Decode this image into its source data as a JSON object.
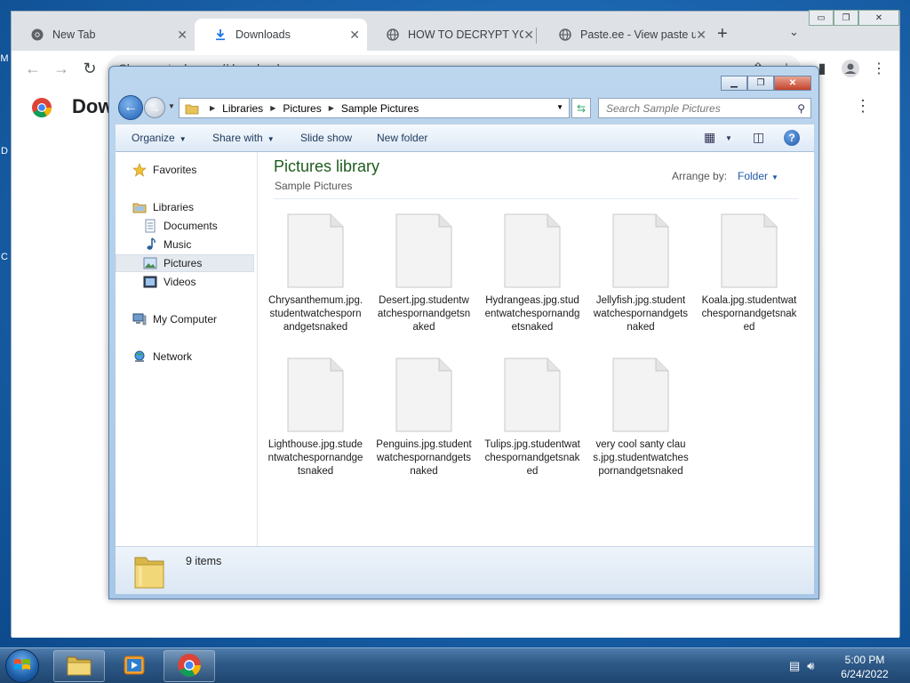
{
  "desktop": {
    "edge_letters": [
      "M",
      "D",
      "C"
    ]
  },
  "chrome": {
    "tabs": [
      {
        "label": "New Tab",
        "icon": "chrome-icon",
        "active": false
      },
      {
        "label": "Downloads",
        "icon": "download-icon",
        "active": true
      },
      {
        "label": "HOW TO DECRYPT YOUR FILES",
        "icon": "globe-icon",
        "active": false
      },
      {
        "label": "Paste.ee - View paste uS",
        "icon": "globe-icon",
        "active": false
      }
    ],
    "new_tab_label": "+",
    "tab_search_label": "⌄",
    "omnibox": {
      "site": "Chrome",
      "url": "chrome://downloads"
    },
    "page_heading": "Dow",
    "window_buttons": [
      "▭",
      "❐",
      "✕"
    ]
  },
  "explorer": {
    "breadcrumb": [
      "Libraries",
      "Pictures",
      "Sample Pictures"
    ],
    "search_placeholder": "Search Sample Pictures",
    "commands": [
      {
        "label": "Organize",
        "has_dropdown": true
      },
      {
        "label": "Share with",
        "has_dropdown": true
      },
      {
        "label": "Slide show",
        "has_dropdown": false
      },
      {
        "label": "New folder",
        "has_dropdown": false
      }
    ],
    "nav": {
      "favorites": "Favorites",
      "libraries": "Libraries",
      "documents": "Documents",
      "music": "Music",
      "pictures": "Pictures",
      "videos": "Videos",
      "computer": "My Computer",
      "network": "Network"
    },
    "library_title": "Pictures library",
    "library_subtitle": "Sample Pictures",
    "arrange_by_label": "Arrange by:",
    "arrange_by_value": "Folder",
    "files": [
      "Chrysanthemum.jpg.studentwatchespornandgetsnaked",
      "Desert.jpg.studentwatchespornandgetsnaked",
      "Hydrangeas.jpg.studentwatchespornandgetsnaked",
      "Jellyfish.jpg.studentwatchespornandgetsnaked",
      "Koala.jpg.studentwatchespornandgetsnaked",
      "Lighthouse.jpg.studentwatchespornandgetsnaked",
      "Penguins.jpg.studentwatchespornandgetsnaked",
      "Tulips.jpg.studentwatchespornandgetsnaked",
      "very cool santy claus.jpg.studentwatchespornandgetsnaked"
    ],
    "item_count": "9 items"
  },
  "taskbar": {
    "time": "5:00 PM",
    "date": "6/24/2022"
  }
}
